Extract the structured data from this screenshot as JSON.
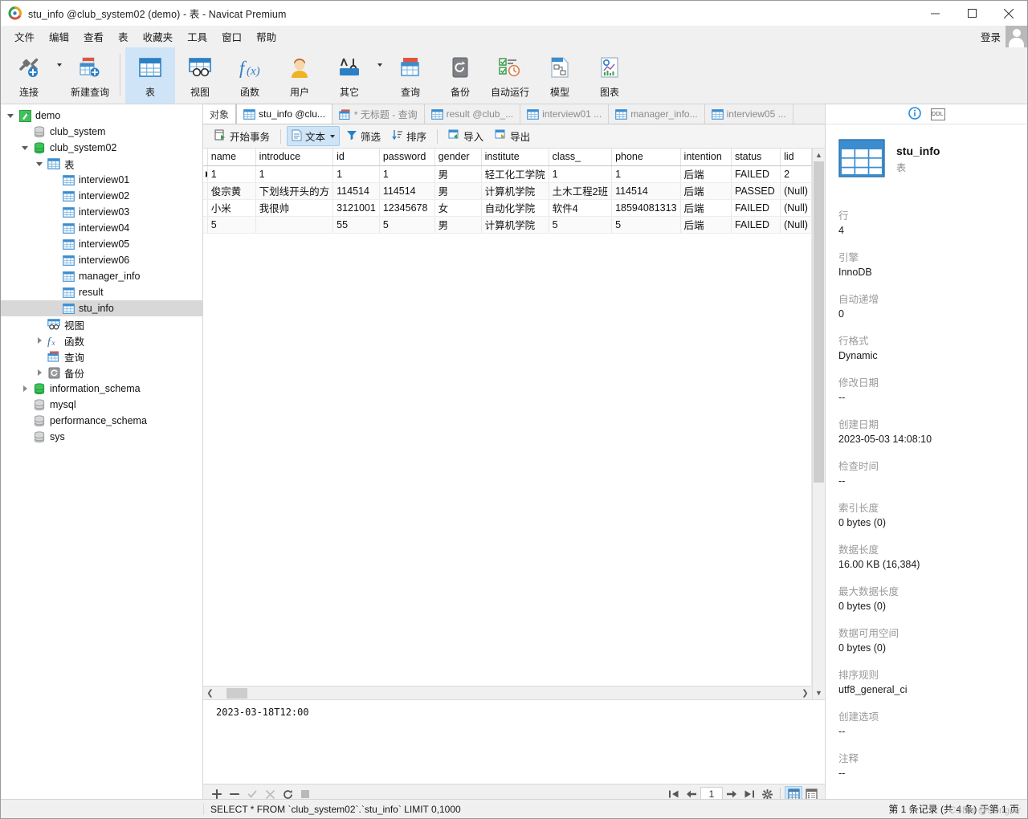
{
  "window": {
    "title": "stu_info @club_system02 (demo) - 表 - Navicat Premium",
    "minimize": "—",
    "maximize": "◻",
    "close": "✕"
  },
  "menubar": {
    "items": [
      "文件",
      "编辑",
      "查看",
      "表",
      "收藏夹",
      "工具",
      "窗口",
      "帮助"
    ],
    "login_label": "登录"
  },
  "ribbon": {
    "items": [
      {
        "label": "连接",
        "icon": "connection-icon",
        "caret": true
      },
      {
        "label": "新建查询",
        "icon": "new-query-icon",
        "caret": false
      },
      {
        "label": "表",
        "icon": "table-icon",
        "caret": false,
        "active": true
      },
      {
        "label": "视图",
        "icon": "view-icon",
        "caret": false
      },
      {
        "label": "函数",
        "icon": "function-icon",
        "caret": false
      },
      {
        "label": "用户",
        "icon": "user-icon",
        "caret": false
      },
      {
        "label": "其它",
        "icon": "other-tools-icon",
        "caret": true
      },
      {
        "label": "查询",
        "icon": "query-icon",
        "caret": false
      },
      {
        "label": "备份",
        "icon": "backup-icon",
        "caret": false
      },
      {
        "label": "自动运行",
        "icon": "automation-icon",
        "caret": false
      },
      {
        "label": "模型",
        "icon": "model-icon",
        "caret": false
      },
      {
        "label": "图表",
        "icon": "chart-icon",
        "caret": false
      }
    ]
  },
  "sidebar": {
    "nodes": [
      {
        "label": "demo",
        "depth": 0,
        "twisty": "down",
        "icon": "navicat-connection-icon"
      },
      {
        "label": "club_system",
        "depth": 1,
        "twisty": "none",
        "icon": "database-icon"
      },
      {
        "label": "club_system02",
        "depth": 1,
        "twisty": "down",
        "icon": "database-open-icon"
      },
      {
        "label": "表",
        "depth": 2,
        "twisty": "down",
        "icon": "tables-folder-icon"
      },
      {
        "label": "interview01",
        "depth": 3,
        "twisty": "none",
        "icon": "table-icon"
      },
      {
        "label": "interview02",
        "depth": 3,
        "twisty": "none",
        "icon": "table-icon"
      },
      {
        "label": "interview03",
        "depth": 3,
        "twisty": "none",
        "icon": "table-icon"
      },
      {
        "label": "interview04",
        "depth": 3,
        "twisty": "none",
        "icon": "table-icon"
      },
      {
        "label": "interview05",
        "depth": 3,
        "twisty": "none",
        "icon": "table-icon"
      },
      {
        "label": "interview06",
        "depth": 3,
        "twisty": "none",
        "icon": "table-icon"
      },
      {
        "label": "manager_info",
        "depth": 3,
        "twisty": "none",
        "icon": "table-icon"
      },
      {
        "label": "result",
        "depth": 3,
        "twisty": "none",
        "icon": "table-icon"
      },
      {
        "label": "stu_info",
        "depth": 3,
        "twisty": "none",
        "icon": "table-icon",
        "selected": true
      },
      {
        "label": "视图",
        "depth": 2,
        "twisty": "none",
        "icon": "views-folder-icon"
      },
      {
        "label": "函数",
        "depth": 2,
        "twisty": "right",
        "icon": "functions-folder-icon"
      },
      {
        "label": "查询",
        "depth": 2,
        "twisty": "none",
        "icon": "queries-folder-icon"
      },
      {
        "label": "备份",
        "depth": 2,
        "twisty": "right",
        "icon": "backups-folder-icon"
      },
      {
        "label": "information_schema",
        "depth": 1,
        "twisty": "right",
        "icon": "database-open-icon"
      },
      {
        "label": "mysql",
        "depth": 1,
        "twisty": "none",
        "icon": "database-icon"
      },
      {
        "label": "performance_schema",
        "depth": 1,
        "twisty": "none",
        "icon": "database-icon"
      },
      {
        "label": "sys",
        "depth": 1,
        "twisty": "none",
        "icon": "database-icon"
      }
    ]
  },
  "tabs": [
    {
      "label": "对象",
      "icon": "none",
      "kind": "object"
    },
    {
      "label": "stu_info @clu...",
      "icon": "table-icon",
      "kind": "active"
    },
    {
      "label": "* 无标题 - 查询",
      "icon": "query-icon",
      "kind": "normal"
    },
    {
      "label": "result @club_...",
      "icon": "table-icon",
      "kind": "normal"
    },
    {
      "label": "interview01 ...",
      "icon": "table-icon",
      "kind": "normal"
    },
    {
      "label": "manager_info...",
      "icon": "table-icon",
      "kind": "normal"
    },
    {
      "label": "interview05 ...",
      "icon": "table-icon",
      "kind": "normal"
    }
  ],
  "gridbar": {
    "begin_transaction": "开始事务",
    "text": "文本",
    "filter": "筛选",
    "sort": "排序",
    "import": "导入",
    "export": "导出"
  },
  "grid": {
    "columns": [
      "name",
      "introduce",
      "id",
      "password",
      "gender",
      "institute",
      "class_",
      "phone",
      "intention",
      "status",
      "lid"
    ],
    "widths": [
      76,
      84,
      38,
      74,
      70,
      76,
      54,
      74,
      72,
      64,
      38
    ],
    "rows": [
      {
        "current": true,
        "cells": [
          "1",
          "1",
          "1",
          "1",
          "男",
          "轻工化工学院",
          "1",
          "1",
          "后端",
          "FAILED",
          "2"
        ]
      },
      {
        "current": false,
        "cells": [
          "俊宗黄",
          "下划线开头的方",
          "114514",
          "114514",
          "男",
          "计算机学院",
          "土木工程2班",
          "114514",
          "后端",
          "PASSED",
          "(Null)"
        ]
      },
      {
        "current": false,
        "cells": [
          "小米",
          "我很帅",
          "3121001",
          "12345678",
          "女",
          "自动化学院",
          "软件4",
          "18594081313",
          "后端",
          "FAILED",
          "(Null)"
        ]
      },
      {
        "current": false,
        "cells": [
          "5",
          "",
          "55",
          "5",
          "男",
          "计算机学院",
          "5",
          "5",
          "后端",
          "FAILED",
          "(Null)"
        ]
      }
    ],
    "null_marker": "(Null)"
  },
  "preview": {
    "value": "2023-03-18T12:00"
  },
  "navbar": {
    "add": "+",
    "remove": "−",
    "confirm": "✓",
    "cancel": "✕",
    "refresh": "↻",
    "stop": "■",
    "first": "⇤",
    "prev": "←",
    "page": "1",
    "next": "→",
    "last": "⇥",
    "settings": "gear-icon",
    "grid_view": "grid-view-icon",
    "form_view": "form-view-icon"
  },
  "info": {
    "tab_info": "info-icon",
    "tab_ddl": "DDL",
    "table_name": "stu_info",
    "table_type": "表",
    "properties": [
      {
        "key": "行",
        "value": "4"
      },
      {
        "key": "引擎",
        "value": "InnoDB"
      },
      {
        "key": "自动递增",
        "value": "0"
      },
      {
        "key": "行格式",
        "value": "Dynamic"
      },
      {
        "key": "修改日期",
        "value": "--"
      },
      {
        "key": "创建日期",
        "value": "2023-05-03 14:08:10"
      },
      {
        "key": "检查时间",
        "value": "--"
      },
      {
        "key": "索引长度",
        "value": "0 bytes (0)"
      },
      {
        "key": "数据长度",
        "value": "16.00 KB (16,384)"
      },
      {
        "key": "最大数据长度",
        "value": "0 bytes (0)"
      },
      {
        "key": "数据可用空间",
        "value": "0 bytes (0)"
      },
      {
        "key": "排序规则",
        "value": "utf8_general_ci"
      },
      {
        "key": "创建选项",
        "value": "--"
      },
      {
        "key": "注释",
        "value": "--"
      }
    ]
  },
  "statusbar": {
    "sql": "SELECT * FROM `club_system02`.`stu_info` LIMIT 0,1000",
    "record_info": "第 1 条记录 (共 4 条) 于第 1 页",
    "watermark": "CSDN @Hongerr"
  },
  "colors": {
    "accent": "#1f7ac0",
    "ribbon_active": "#cfe5f7",
    "selection": "#d8d8d8",
    "null_text": "#b6b6cf",
    "green_db": "#2ea84f"
  }
}
